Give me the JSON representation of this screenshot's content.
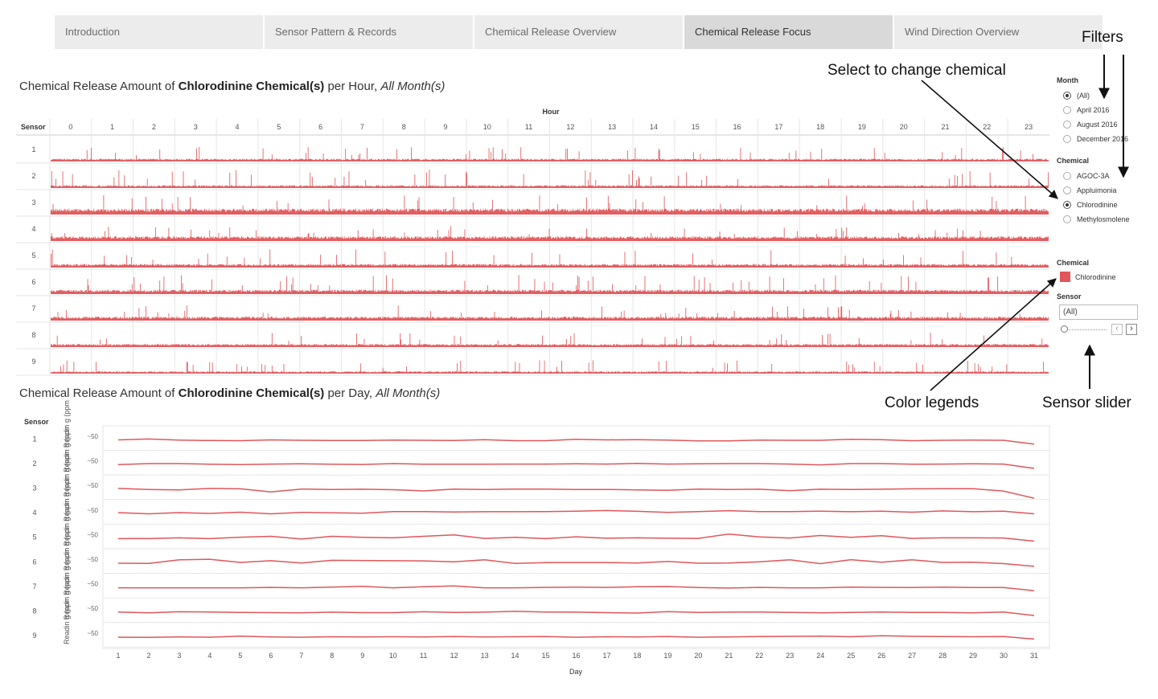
{
  "tabs": [
    "Introduction",
    "Sensor Pattern & Records",
    "Chemical Release Overview",
    "Chemical Release Focus",
    "Wind Direction Overview"
  ],
  "active_tab": 3,
  "titles": {
    "hour": {
      "pre": "Chemical Release Amount of ",
      "bold": "Chlorodinine Chemical(s)",
      "mid": " per Hour, ",
      "ital": "All Month(s)"
    },
    "day": {
      "pre": "Chemical Release Amount of ",
      "bold": "Chlorodinine Chemical(s)",
      "mid": " per Day, ",
      "ital": "All Month(s)"
    }
  },
  "annotations": {
    "filters": "Filters",
    "select_chemical": "Select to change chemical",
    "color_legends": "Color legends",
    "sensor_slider": "Sensor slider"
  },
  "filters": {
    "month_title": "Month",
    "months": [
      "(All)",
      "April 2016",
      "August 2016",
      "December 2016"
    ],
    "month_selected": 0,
    "chemical_title": "Chemical",
    "chemicals": [
      "AGOC-3A",
      "Appluimonia",
      "Chlorodinine",
      "Methylosmolene"
    ],
    "chemical_selected": 2,
    "legend_title": "Chemical",
    "legend_items": [
      {
        "label": "Chlorodinine",
        "color": "#e05659"
      }
    ],
    "sensor_title": "Sensor",
    "sensor_value": "(All)",
    "prev_icon": "‹",
    "next_icon": "›"
  },
  "colors": {
    "series": "#e05659",
    "grid": "#e6e6e6"
  },
  "chart_data": [
    {
      "type": "bar",
      "title": "Chemical Release Amount of Chlorodinine Chemical(s) per Hour, All Month(s)",
      "column_header": "Hour",
      "row_header": "Sensor",
      "columns": [
        "0",
        "1",
        "2",
        "3",
        "4",
        "5",
        "6",
        "7",
        "8",
        "9",
        "10",
        "11",
        "12",
        "13",
        "14",
        "15",
        "16",
        "17",
        "18",
        "19",
        "20",
        "21",
        "22",
        "23"
      ],
      "rows": [
        "1",
        "2",
        "3",
        "4",
        "5",
        "6",
        "7",
        "8",
        "9"
      ],
      "bars_per_cell": 60,
      "relative_bar_level": [
        0.35,
        0.35,
        0.75,
        0.6,
        0.45,
        0.55,
        0.5,
        0.4,
        0.3
      ],
      "relative_peak_level": [
        0.75,
        0.95,
        1.0,
        0.8,
        0.95,
        1.0,
        0.8,
        0.75,
        0.7
      ],
      "series": [
        {
          "name": "Chlorodinine"
        }
      ]
    },
    {
      "type": "line",
      "title": "Chemical Release Amount of Chlorodinine Chemical(s) per Day, All Month(s)",
      "xlabel": "Day",
      "ylabel": "Reading (ppm)",
      "row_header": "Sensor",
      "row_axis_label": "Readin g (ppm",
      "row_axis_tick": "~50",
      "rows": [
        "1",
        "2",
        "3",
        "4",
        "5",
        "6",
        "7",
        "8",
        "9"
      ],
      "x": [
        1,
        2,
        3,
        4,
        5,
        6,
        7,
        8,
        9,
        10,
        11,
        12,
        13,
        14,
        15,
        16,
        17,
        18,
        19,
        20,
        21,
        22,
        23,
        24,
        25,
        26,
        27,
        28,
        29,
        30,
        31
      ],
      "series": [
        {
          "sensor": "1",
          "name": "Chlorodinine",
          "values": [
            50.2,
            50.6,
            50.1,
            49.9,
            49.8,
            50.2,
            50.0,
            49.9,
            49.9,
            50.1,
            50.0,
            49.9,
            50.3,
            49.8,
            49.8,
            50.5,
            50.2,
            50.3,
            50.1,
            49.7,
            49.7,
            50.1,
            50.0,
            50.0,
            50.5,
            50.3,
            49.8,
            50.0,
            50.1,
            50.0,
            48.2
          ]
        },
        {
          "sensor": "2",
          "name": "Chlorodinine",
          "values": [
            50.1,
            50.6,
            50.6,
            50.3,
            50.1,
            50.4,
            50.5,
            50.3,
            50.2,
            50.6,
            50.3,
            50.3,
            50.3,
            50.4,
            50.4,
            50.5,
            50.4,
            50.7,
            50.4,
            50.5,
            50.6,
            50.6,
            50.4,
            50.0,
            50.6,
            50.6,
            50.3,
            50.4,
            50.5,
            50.4,
            48.3
          ]
        },
        {
          "sensor": "3",
          "name": "Chlorodinine",
          "values": [
            50.5,
            50.0,
            49.8,
            50.5,
            50.3,
            48.8,
            50.2,
            50.0,
            50.1,
            49.9,
            49.3,
            50.2,
            50.0,
            50.2,
            50.2,
            50.0,
            50.0,
            49.8,
            49.6,
            50.2,
            50.0,
            50.1,
            49.4,
            50.1,
            50.0,
            50.1,
            50.3,
            50.4,
            50.4,
            49.2,
            45.8
          ]
        },
        {
          "sensor": "4",
          "name": "Chlorodinine",
          "values": [
            50.7,
            50.1,
            50.7,
            50.3,
            50.9,
            50.1,
            50.8,
            50.6,
            50.4,
            51.2,
            51.2,
            51.0,
            51.1,
            51.1,
            51.2,
            51.4,
            51.7,
            51.3,
            50.8,
            51.2,
            51.6,
            51.2,
            51.2,
            51.4,
            51.1,
            51.4,
            50.9,
            51.5,
            51.1,
            51.4,
            50.1
          ]
        },
        {
          "sensor": "5",
          "name": "Chlorodinine",
          "values": [
            50.0,
            50.0,
            50.4,
            50.0,
            50.7,
            51.1,
            49.8,
            51.1,
            50.6,
            50.4,
            51.1,
            51.8,
            50.1,
            50.6,
            50.0,
            50.9,
            50.2,
            50.4,
            50.2,
            50.1,
            52.2,
            50.8,
            50.3,
            51.5,
            50.6,
            51.4,
            50.1,
            50.4,
            50.4,
            50.3,
            48.8
          ]
        },
        {
          "sensor": "6",
          "name": "Chlorodinine",
          "values": [
            50.0,
            49.9,
            51.6,
            51.9,
            50.4,
            51.2,
            50.1,
            51.4,
            51.3,
            51.2,
            51.1,
            50.7,
            51.6,
            49.9,
            50.3,
            50.3,
            50.3,
            50.1,
            50.9,
            50.0,
            50.1,
            50.7,
            51.6,
            49.8,
            51.7,
            50.5,
            51.6,
            50.4,
            50.5,
            49.8,
            48.5
          ]
        },
        {
          "sensor": "7",
          "name": "Chlorodinine",
          "values": [
            50.0,
            50.0,
            50.0,
            50.0,
            50.0,
            50.2,
            50.0,
            50.3,
            50.7,
            50.0,
            50.5,
            50.9,
            50.0,
            50.0,
            50.2,
            50.3,
            50.2,
            50.5,
            50.6,
            50.1,
            49.9,
            50.2,
            50.0,
            50.0,
            50.3,
            50.2,
            50.1,
            50.3,
            50.1,
            50.1,
            48.6
          ]
        },
        {
          "sensor": "8",
          "name": "Chlorodinine",
          "values": [
            50.2,
            49.8,
            50.3,
            50.2,
            50.0,
            49.9,
            49.8,
            50.1,
            49.9,
            49.9,
            50.3,
            50.0,
            50.1,
            50.5,
            50.2,
            50.1,
            49.9,
            49.7,
            50.4,
            50.0,
            50.1,
            50.2,
            50.0,
            49.8,
            50.0,
            50.2,
            50.0,
            50.0,
            49.8,
            50.2,
            48.5
          ]
        },
        {
          "sensor": "9",
          "name": "Chlorodinine",
          "values": [
            49.9,
            49.8,
            50.0,
            49.9,
            50.4,
            50.0,
            49.9,
            50.1,
            50.0,
            50.1,
            50.0,
            50.2,
            50.0,
            50.1,
            50.2,
            49.9,
            50.1,
            50.0,
            50.2,
            49.9,
            50.0,
            50.2,
            50.3,
            50.4,
            50.1,
            50.6,
            50.3,
            50.2,
            50.1,
            50.2,
            49.0
          ]
        }
      ]
    }
  ]
}
